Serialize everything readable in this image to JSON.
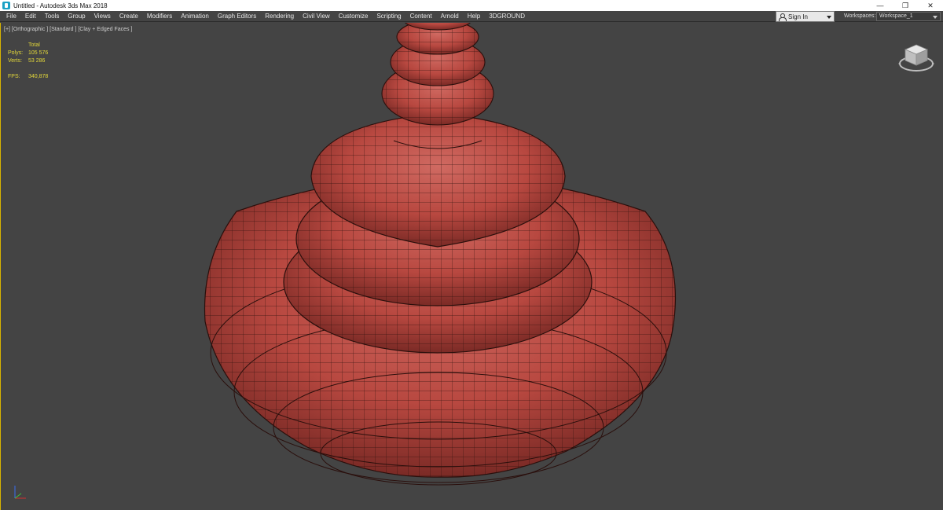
{
  "window": {
    "title": "Untitled - Autodesk 3ds Max 2018",
    "controls": {
      "minimize": "—",
      "restore": "❐",
      "close": "✕"
    }
  },
  "menu": {
    "items": [
      "File",
      "Edit",
      "Tools",
      "Group",
      "Views",
      "Create",
      "Modifiers",
      "Animation",
      "Graph Editors",
      "Rendering",
      "Civil View",
      "Customize",
      "Scripting",
      "Content",
      "Arnold",
      "Help",
      "3DGROUND"
    ],
    "sign_in": "Sign In",
    "workspaces_label": "Workspaces:",
    "workspace_value": "Workspace_1"
  },
  "viewport": {
    "label": "[+] [Orthographic ] [Standard ] [Clay + Edged Faces ]",
    "stats": {
      "total_label": "Total",
      "polys_label": "Polys:",
      "polys_value": "105 576",
      "verts_label": "Verts:",
      "verts_value": "53 286",
      "fps_label": "FPS:",
      "fps_value": "340,878"
    }
  },
  "colors": {
    "viewport_bg": "#444444",
    "model_clay": "#b84840",
    "stats_text": "#e3d83a",
    "active_border": "#d7b300"
  },
  "icons": {
    "app": "3dsmax-app-icon",
    "user": "user-icon",
    "viewcube": "viewcube-icon",
    "axis": "axis-tripod-icon"
  }
}
